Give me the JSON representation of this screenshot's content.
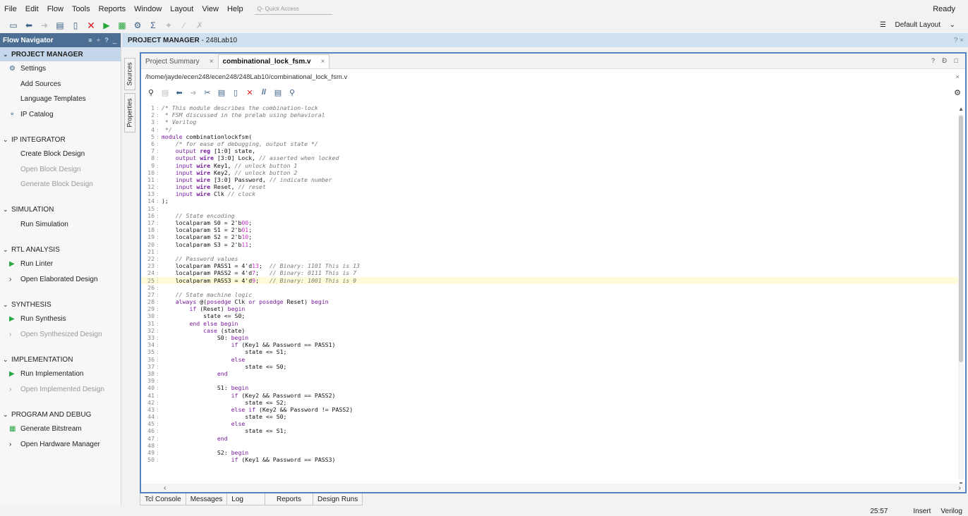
{
  "menu": [
    "File",
    "Edit",
    "Flow",
    "Tools",
    "Reports",
    "Window",
    "Layout",
    "View",
    "Help"
  ],
  "quick_access": "Q- Quick Access",
  "status_ready": "Ready",
  "layout_select": "Default Layout",
  "flow_nav": {
    "title": "Flow Navigator",
    "controls": "≡ ÷ ? _",
    "sections": [
      {
        "label": "PROJECT MANAGER",
        "items": [
          {
            "label": "Settings",
            "icon": "gear-icon"
          },
          {
            "label": "Add Sources"
          },
          {
            "label": "Language Templates"
          },
          {
            "label": "IP Catalog",
            "icon": "ip-catalog-icon"
          }
        ]
      },
      {
        "label": "IP INTEGRATOR",
        "items": [
          {
            "label": "Create Block Design"
          },
          {
            "label": "Open Block Design"
          },
          {
            "label": "Generate Block Design"
          }
        ]
      },
      {
        "label": "SIMULATION",
        "items": [
          {
            "label": "Run Simulation"
          }
        ]
      },
      {
        "label": "RTL ANALYSIS",
        "items": [
          {
            "label": "Run Linter",
            "icon": "play-icon"
          },
          {
            "label": "Open Elaborated Design",
            "icon": "chevron-right-icon"
          }
        ]
      },
      {
        "label": "SYNTHESIS",
        "items": [
          {
            "label": "Run Synthesis",
            "icon": "play-icon"
          },
          {
            "label": "Open Synthesized Design",
            "icon": "chevron-right-icon"
          }
        ]
      },
      {
        "label": "IMPLEMENTATION",
        "items": [
          {
            "label": "Run Implementation",
            "icon": "play-icon"
          },
          {
            "label": "Open Implemented Design",
            "icon": "chevron-right-icon"
          }
        ]
      },
      {
        "label": "PROGRAM AND DEBUG",
        "items": [
          {
            "label": "Generate Bitstream",
            "icon": "bitstream-icon"
          },
          {
            "label": "Open Hardware Manager",
            "icon": "chevron-right-icon"
          }
        ]
      }
    ]
  },
  "pm_header": {
    "title": "PROJECT MANAGER",
    "project": " - 248Lab10",
    "right": "? ×"
  },
  "vtabs": [
    "Sources",
    "Properties"
  ],
  "editor": {
    "tabs": [
      {
        "label": "Project Summary"
      },
      {
        "label": "combinational_lock_fsm.v"
      }
    ],
    "tab_controls": "? Ɖ □",
    "path": "/home/jayde/ecen248/ecen248/248Lab10/combinational_lock_fsm.v"
  },
  "code": [
    [
      {
        "t": "/* This module describes the combination-lock",
        "c": "cmt"
      }
    ],
    [
      {
        "t": " * FSM discussed in the prelab using behavioral",
        "c": "cmt"
      }
    ],
    [
      {
        "t": " * Verilog",
        "c": "cmt"
      }
    ],
    [
      {
        "t": " */",
        "c": "cmt"
      }
    ],
    [
      {
        "t": "module",
        "c": "kw"
      },
      {
        "t": " combinationlockfsm("
      }
    ],
    [
      {
        "t": "    "
      },
      {
        "t": "/* for ease of debugging, output state */",
        "c": "cmt"
      }
    ],
    [
      {
        "t": "    "
      },
      {
        "t": "output",
        "c": "kw"
      },
      {
        "t": " "
      },
      {
        "t": "reg",
        "c": "kwb"
      },
      {
        "t": " [1:0] state,"
      }
    ],
    [
      {
        "t": "    "
      },
      {
        "t": "output",
        "c": "kw"
      },
      {
        "t": " "
      },
      {
        "t": "wire",
        "c": "kwb"
      },
      {
        "t": " [3:0] Lock, "
      },
      {
        "t": "// asserted when locked",
        "c": "cmt"
      }
    ],
    [
      {
        "t": "    "
      },
      {
        "t": "input",
        "c": "kw"
      },
      {
        "t": " "
      },
      {
        "t": "wire",
        "c": "kwb"
      },
      {
        "t": " Key1, "
      },
      {
        "t": "// unlock button 1",
        "c": "cmt"
      }
    ],
    [
      {
        "t": "    "
      },
      {
        "t": "input",
        "c": "kw"
      },
      {
        "t": " "
      },
      {
        "t": "wire",
        "c": "kwb"
      },
      {
        "t": " Key2, "
      },
      {
        "t": "// unlock button 2",
        "c": "cmt"
      }
    ],
    [
      {
        "t": "    "
      },
      {
        "t": "input",
        "c": "kw"
      },
      {
        "t": " "
      },
      {
        "t": "wire",
        "c": "kwb"
      },
      {
        "t": " [3:0] Password, "
      },
      {
        "t": "// indicate number",
        "c": "cmt"
      }
    ],
    [
      {
        "t": "    "
      },
      {
        "t": "input",
        "c": "kw"
      },
      {
        "t": " "
      },
      {
        "t": "wire",
        "c": "kwb"
      },
      {
        "t": " Reset, "
      },
      {
        "t": "// reset",
        "c": "cmt"
      }
    ],
    [
      {
        "t": "    "
      },
      {
        "t": "input",
        "c": "kw"
      },
      {
        "t": " "
      },
      {
        "t": "wire",
        "c": "kwb"
      },
      {
        "t": " Clk "
      },
      {
        "t": "// clock",
        "c": "cmt"
      }
    ],
    [
      {
        "t": ");"
      }
    ],
    [
      {
        "t": ""
      }
    ],
    [
      {
        "t": "    "
      },
      {
        "t": "// State encoding",
        "c": "cmt"
      }
    ],
    [
      {
        "t": "    localparam S0 = 2'b"
      },
      {
        "t": "00",
        "c": "num"
      },
      {
        "t": ";"
      }
    ],
    [
      {
        "t": "    localparam S1 = 2'b"
      },
      {
        "t": "01",
        "c": "num"
      },
      {
        "t": ";"
      }
    ],
    [
      {
        "t": "    localparam S2 = 2'b"
      },
      {
        "t": "10",
        "c": "num"
      },
      {
        "t": ";"
      }
    ],
    [
      {
        "t": "    localparam S3 = 2'b"
      },
      {
        "t": "11",
        "c": "num"
      },
      {
        "t": ";"
      }
    ],
    [
      {
        "t": ""
      }
    ],
    [
      {
        "t": "    "
      },
      {
        "t": "// Password values",
        "c": "cmt"
      }
    ],
    [
      {
        "t": "    localparam PASS1 = 4'd"
      },
      {
        "t": "13",
        "c": "num"
      },
      {
        "t": ";  "
      },
      {
        "t": "// Binary: 1101 This is 13",
        "c": "cmt"
      }
    ],
    [
      {
        "t": "    localparam PASS2 = 4'd"
      },
      {
        "t": "7",
        "c": "num"
      },
      {
        "t": ";   "
      },
      {
        "t": "// Binary: 0111 This is 7",
        "c": "cmt"
      }
    ],
    [
      {
        "t": "    localparam PASS3 = 4'd"
      },
      {
        "t": "9",
        "c": "num"
      },
      {
        "t": ";   "
      },
      {
        "t": "// Binary: 1001 This is 9",
        "c": "cmt"
      }
    ],
    [
      {
        "t": ""
      }
    ],
    [
      {
        "t": "    "
      },
      {
        "t": "// State machine logic",
        "c": "cmt"
      }
    ],
    [
      {
        "t": "    "
      },
      {
        "t": "always",
        "c": "kw"
      },
      {
        "t": " @("
      },
      {
        "t": "posedge",
        "c": "kw"
      },
      {
        "t": " Clk "
      },
      {
        "t": "or",
        "c": "kw"
      },
      {
        "t": " "
      },
      {
        "t": "posedge",
        "c": "kw"
      },
      {
        "t": " Reset) "
      },
      {
        "t": "begin",
        "c": "kw"
      }
    ],
    [
      {
        "t": "        "
      },
      {
        "t": "if",
        "c": "kw"
      },
      {
        "t": " (Reset) "
      },
      {
        "t": "begin",
        "c": "kw"
      }
    ],
    [
      {
        "t": "            state <= S0;"
      }
    ],
    [
      {
        "t": "        "
      },
      {
        "t": "end else begin",
        "c": "kw"
      }
    ],
    [
      {
        "t": "            "
      },
      {
        "t": "case",
        "c": "kw"
      },
      {
        "t": " (state)"
      }
    ],
    [
      {
        "t": "                S0: "
      },
      {
        "t": "begin",
        "c": "kw"
      }
    ],
    [
      {
        "t": "                    "
      },
      {
        "t": "if",
        "c": "kw"
      },
      {
        "t": " (Key1 && Password == PASS1)"
      }
    ],
    [
      {
        "t": "                        state <= S1;"
      }
    ],
    [
      {
        "t": "                    "
      },
      {
        "t": "else",
        "c": "kw"
      }
    ],
    [
      {
        "t": "                        state <= S0;"
      }
    ],
    [
      {
        "t": "                "
      },
      {
        "t": "end",
        "c": "kw"
      }
    ],
    [
      {
        "t": ""
      }
    ],
    [
      {
        "t": "                S1: "
      },
      {
        "t": "begin",
        "c": "kw"
      }
    ],
    [
      {
        "t": "                    "
      },
      {
        "t": "if",
        "c": "kw"
      },
      {
        "t": " (Key2 && Password == PASS2)"
      }
    ],
    [
      {
        "t": "                        state <= S2;"
      }
    ],
    [
      {
        "t": "                    "
      },
      {
        "t": "else if",
        "c": "kw"
      },
      {
        "t": " (Key2 && Password != PASS2)"
      }
    ],
    [
      {
        "t": "                        state <= S0;"
      }
    ],
    [
      {
        "t": "                    "
      },
      {
        "t": "else",
        "c": "kw"
      }
    ],
    [
      {
        "t": "                        state <= S1;"
      }
    ],
    [
      {
        "t": "                "
      },
      {
        "t": "end",
        "c": "kw"
      }
    ],
    [
      {
        "t": ""
      }
    ],
    [
      {
        "t": "                S2: "
      },
      {
        "t": "begin",
        "c": "kw"
      }
    ],
    [
      {
        "t": "                    "
      },
      {
        "t": "if",
        "c": "kw"
      },
      {
        "t": " (Key1 && Password == PASS3)"
      }
    ]
  ],
  "highlight_line": 25,
  "bottom_tabs": [
    "Tcl Console",
    "Messages",
    "Log",
    "Reports",
    "Design Runs"
  ],
  "status": {
    "position": "25:57",
    "mode": "Insert",
    "language": "Verilog"
  }
}
